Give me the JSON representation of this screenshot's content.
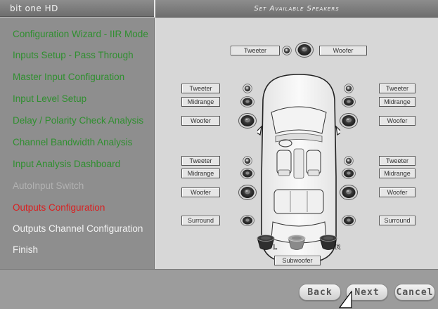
{
  "app": {
    "title": "bit one HD"
  },
  "panel": {
    "title": "Set Available Speakers"
  },
  "sidebar": {
    "items": [
      {
        "label": "Configuration Wizard - IIR Mode",
        "state": "done"
      },
      {
        "label": "Inputs Setup - Pass Through",
        "state": "done"
      },
      {
        "label": "Master Input Configuration",
        "state": "done"
      },
      {
        "label": "Input Level Setup",
        "state": "done"
      },
      {
        "label": "Delay / Polarity Check Analysis",
        "state": "done"
      },
      {
        "label": "Channel Bandwidth Analysis",
        "state": "done"
      },
      {
        "label": "Input Analysis Dashboard",
        "state": "done"
      },
      {
        "label": "AutoInput Switch",
        "state": "disabled"
      },
      {
        "label": "Outputs Configuration",
        "state": "current"
      },
      {
        "label": "Outputs Channel Configuration",
        "state": "pending"
      },
      {
        "label": "Finish",
        "state": "pending"
      }
    ]
  },
  "speakers": {
    "center_tweeter": "Tweeter",
    "center_woofer": "Woofer",
    "front_left": {
      "tweeter": "Tweeter",
      "midrange": "Midrange",
      "woofer": "Woofer"
    },
    "front_right": {
      "tweeter": "Tweeter",
      "midrange": "Midrange",
      "woofer": "Woofer"
    },
    "rear_left": {
      "tweeter": "Tweeter",
      "midrange": "Midrange",
      "woofer": "Woofer"
    },
    "rear_right": {
      "tweeter": "Tweeter",
      "midrange": "Midrange",
      "woofer": "Woofer"
    },
    "surround_left": "Surround",
    "surround_right": "Surround",
    "subwoofer": "Subwoofer",
    "sub_left_mark": "L",
    "sub_right_mark": "R"
  },
  "buttons": {
    "back": "Back",
    "next": "Next",
    "cancel": "Cancel"
  },
  "colors": {
    "done": "#2f8f2f",
    "current": "#d92020",
    "disabled": "#b2b2b2",
    "pending": "#f2f2f2"
  }
}
